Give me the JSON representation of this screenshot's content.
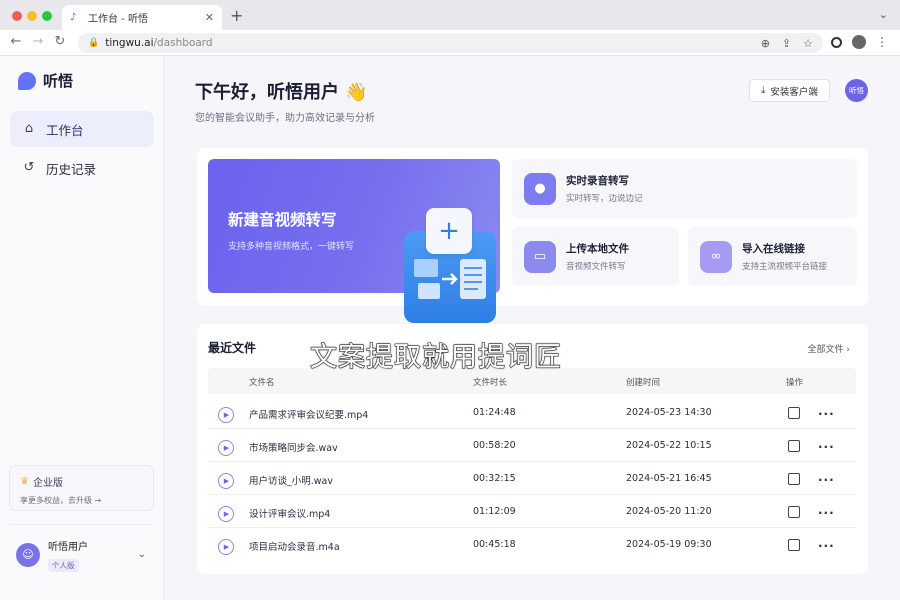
{
  "browser": {
    "tab_title": "工作台 - 听悟",
    "url_host": "tingwu.ai",
    "url_path": "/dashboard"
  },
  "sidebar": {
    "logo": "听悟",
    "items": [
      {
        "label": "工作台",
        "active": true
      },
      {
        "label": "历史记录",
        "active": false
      }
    ],
    "enterprise": {
      "title": "企业版",
      "subtitle": "享更多权益，去升级 →"
    },
    "user": {
      "name": "听悟用户",
      "plan": "个人版"
    }
  },
  "header": {
    "greeting": "下午好，听悟用户 👋",
    "subtitle": "您的智能会议助手，助力高效记录与分析",
    "install_label": "安装客户端",
    "avatar_label": "听悟"
  },
  "hero": {
    "title": "新建音视频转写",
    "subtitle": "支持多种音视频格式，一键转写"
  },
  "quick_actions": [
    {
      "title": "实时录音转写",
      "subtitle": "实时转写，边说边记",
      "icon": "microphone-icon",
      "color": "#7d7cf0"
    },
    {
      "title": "上传本地文件",
      "subtitle": "音视频文件转写",
      "icon": "folder-icon",
      "color": "#8a8aef"
    },
    {
      "title": "导入在线链接",
      "subtitle": "支持主流视频平台链接",
      "icon": "link-icon",
      "color": "#a69bf2"
    }
  ],
  "files": {
    "title": "最近文件",
    "all_label": "全部文件",
    "columns": [
      "文件名",
      "文件时长",
      "创建时间",
      "操作"
    ],
    "rows": [
      {
        "name": "产品需求评审会议纪要.mp4",
        "duration": "01:24:48",
        "created": "2024-05-23 14:30"
      },
      {
        "name": "市场策略同步会.wav",
        "duration": "00:58:20",
        "created": "2024-05-22 10:15"
      },
      {
        "name": "用户访谈_小明.wav",
        "duration": "00:32:15",
        "created": "2024-05-21 16:45"
      },
      {
        "name": "设计评审会议.mp4",
        "duration": "01:12:09",
        "created": "2024-05-20 11:20"
      },
      {
        "name": "项目启动会录音.m4a",
        "duration": "00:45:18",
        "created": "2024-05-19 09:30"
      }
    ]
  },
  "watermark": "文案提取就用提词匠"
}
